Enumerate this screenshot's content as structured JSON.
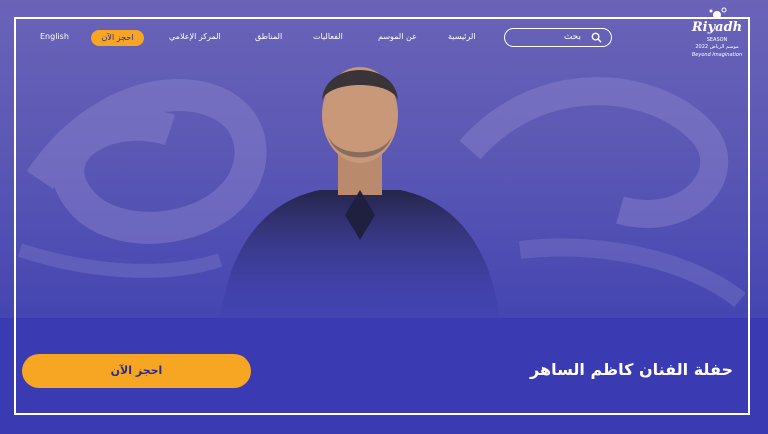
{
  "nav": {
    "language": "English",
    "book_now": "احجز الآن",
    "items": [
      {
        "label": "المركز الإعلامي"
      },
      {
        "label": "المناطق"
      },
      {
        "label": "الفعاليات"
      },
      {
        "label": "عن الموسم"
      },
      {
        "label": "الرئيسية"
      }
    ],
    "search_placeholder": "بحث"
  },
  "logo": {
    "title": "Riyadh",
    "subtitle": "SEASON",
    "arabic": "موسم الرياض",
    "year": "2022",
    "tagline": "Beyond Imagination"
  },
  "hero": {
    "event_title": "حفلة الفنان كاظم الساهر",
    "book_button": "احجز الآن"
  },
  "colors": {
    "accent": "#f6a623",
    "band": "#3a3ab3",
    "text": "#ffffff"
  }
}
